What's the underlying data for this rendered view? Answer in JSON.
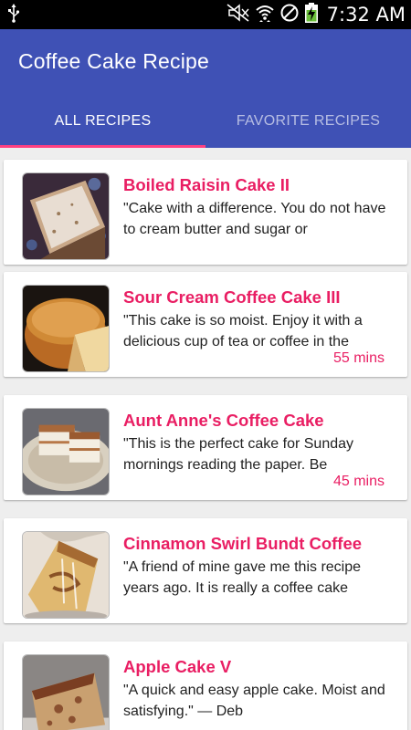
{
  "status_bar": {
    "time": "7:32 AM",
    "icons": [
      "usb-icon",
      "mute-icon",
      "wifi-icon",
      "no-sim-icon",
      "battery-charging-icon"
    ]
  },
  "app_bar": {
    "title": "Coffee Cake Recipe",
    "color": "#3f51b5"
  },
  "tabs": [
    {
      "label": "ALL RECIPES",
      "active": true
    },
    {
      "label": "FAVORITE RECIPES",
      "active": false
    }
  ],
  "accent_color": "#ff4081",
  "title_color": "#e91e63",
  "recipes": [
    {
      "title": "Boiled Raisin Cake II",
      "description": "\"Cake with a difference. You do not have to cream butter and sugar or",
      "time": ""
    },
    {
      "title": "Sour Cream Coffee Cake III",
      "description": "\"This cake is so moist. Enjoy it with a delicious cup of tea or coffee in the",
      "time": "55 mins"
    },
    {
      "title": "Aunt Anne's Coffee Cake",
      "description": "\"This is the perfect cake for Sunday mornings reading the paper. Be",
      "time": "45 mins"
    },
    {
      "title": "Cinnamon Swirl Bundt Coffee",
      "description": "\"A friend of mine gave me this recipe years ago. It is really a coffee cake",
      "time": ""
    },
    {
      "title": "Apple Cake V",
      "description": "\"A quick and easy apple cake. Moist and satisfying.\" — Deb",
      "time": ""
    }
  ]
}
